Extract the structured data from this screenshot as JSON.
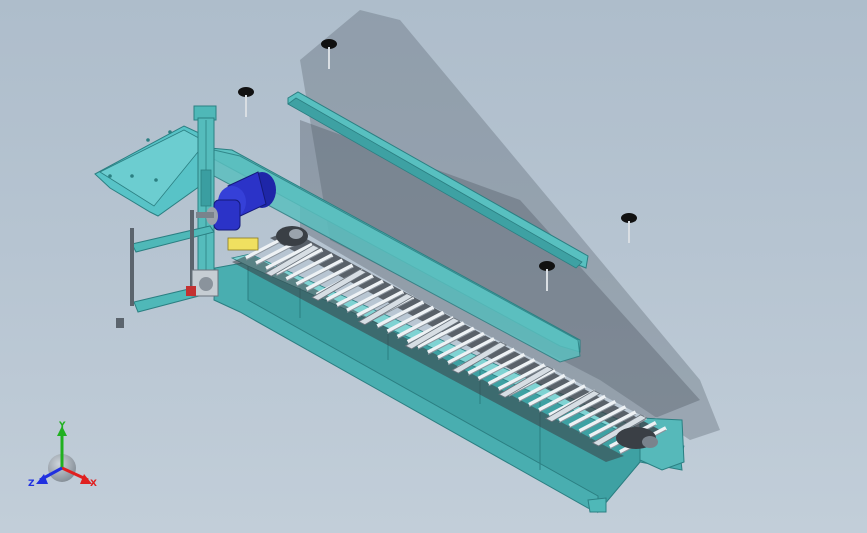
{
  "viewport": {
    "background_top": "#aebdcb",
    "background_bottom": "#c2ced9"
  },
  "model": {
    "frame_color": "#4fb8b8",
    "frame_dark": "#2b7f82",
    "frame_light": "#7fd3d3",
    "motor_color": "#2b33c8",
    "roller_color": "#e4e9ee",
    "chain_color": "#3a3f45",
    "bolt_icons": [
      "bolt-icon",
      "bolt-icon",
      "bolt-icon",
      "bolt-icon"
    ]
  },
  "triad": {
    "x_label": "X",
    "y_label": "Y",
    "z_label": "Z",
    "x_color": "#e02020",
    "y_color": "#20b020",
    "z_color": "#2030e0"
  }
}
